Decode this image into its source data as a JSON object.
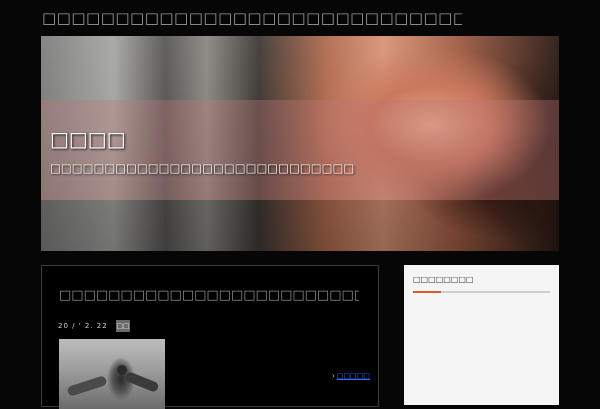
{
  "site": {
    "title": "□□□□□□□□□□□□□□□□□□□□□□□□□□□□□"
  },
  "hero": {
    "title": "□□□□",
    "description": "□□□□□□□□□□□□□□□□□□□□□□□□□□□□"
  },
  "post": {
    "title": "□□□□□□□□□□□□□□□□□□□□□□□□□□□",
    "date": "20 / ' 2. 22",
    "category": "□□",
    "more_link": "□□□□□"
  },
  "sidebar": {
    "widget_title": "□□□□□□□□"
  },
  "colors": {
    "page_bg": "#060606",
    "accent": "#e0582f",
    "link": "#3b6dff"
  }
}
